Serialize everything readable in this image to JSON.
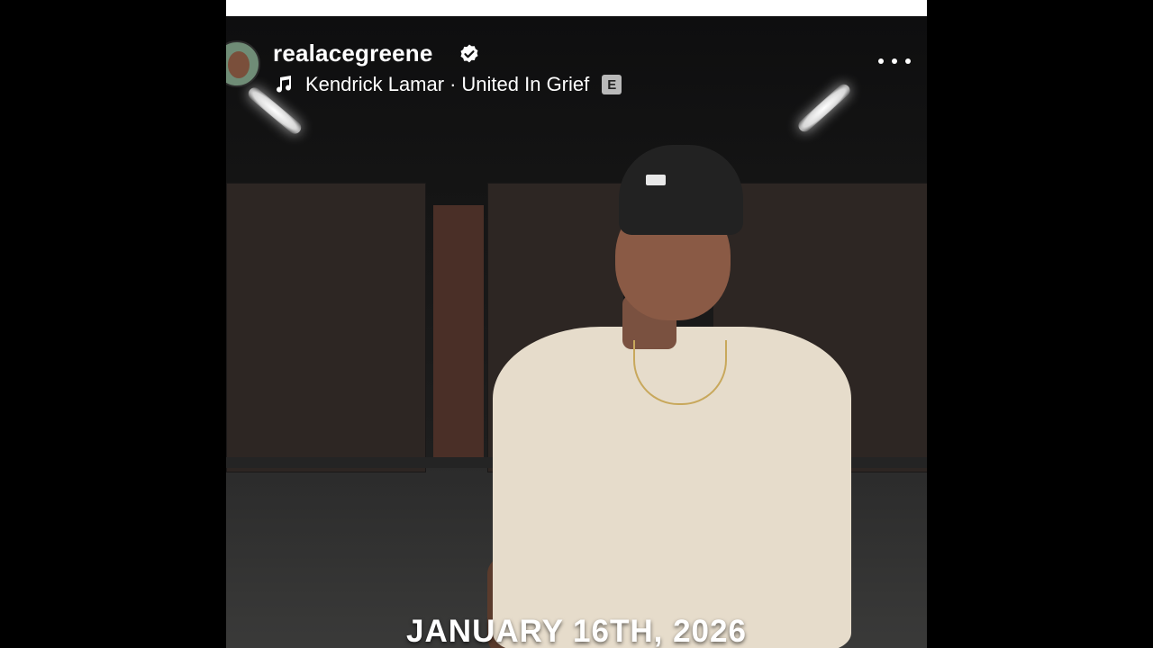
{
  "post": {
    "username": "realacegreene",
    "verified_icon": "verified-badge-icon",
    "music": {
      "icon": "music-note-icon",
      "artist": "Kendrick Lamar",
      "separator": "·",
      "track": "United In Grief",
      "explicit_label": "E"
    },
    "more_icon": "more-options-icon",
    "caption": "JANUARY 16TH, 2026"
  },
  "colors": {
    "background": "#000000",
    "text": "#ffffff",
    "explicit_bg": "#b9b9b9"
  }
}
